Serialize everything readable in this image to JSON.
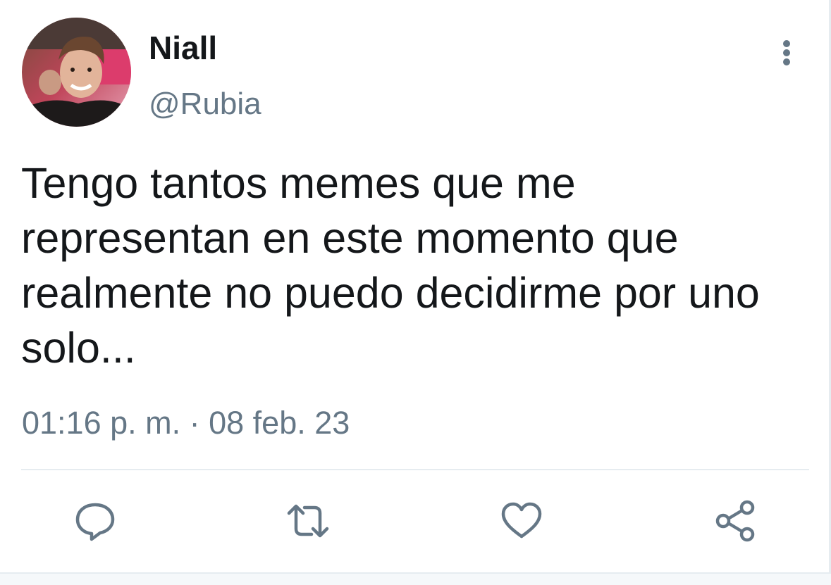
{
  "tweet": {
    "author": {
      "display_name": "Niall",
      "handle": "@Rubia",
      "avatar_icon": "profile-photo"
    },
    "text": "Tengo tantos memes que me representan en este momento que realmente no puedo decidirme por uno solo...",
    "timestamp": "01:16 p. m. · 08 feb. 23",
    "more_icon": "vertical-dots-icon"
  },
  "actions": [
    {
      "name": "reply",
      "icon": "speech-bubble-icon"
    },
    {
      "name": "retweet",
      "icon": "retweet-arrows-icon"
    },
    {
      "name": "like",
      "icon": "heart-icon"
    },
    {
      "name": "share",
      "icon": "share-nodes-icon"
    }
  ],
  "colors": {
    "text_primary": "#14171a",
    "text_secondary": "#657786",
    "divider": "#e6ecf0",
    "icon": "#657786"
  }
}
